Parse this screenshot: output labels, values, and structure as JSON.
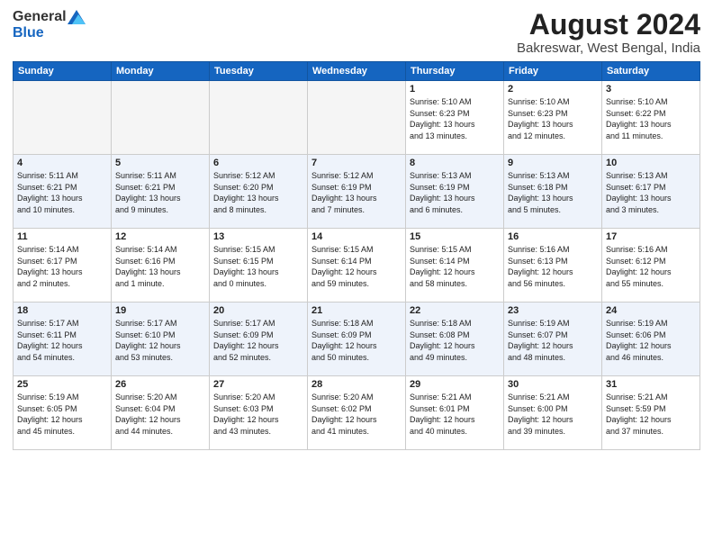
{
  "header": {
    "logo_general": "General",
    "logo_blue": "Blue",
    "main_title": "August 2024",
    "sub_title": "Bakreswar, West Bengal, India"
  },
  "weekdays": [
    "Sunday",
    "Monday",
    "Tuesday",
    "Wednesday",
    "Thursday",
    "Friday",
    "Saturday"
  ],
  "weeks": [
    [
      {
        "day": "",
        "info": ""
      },
      {
        "day": "",
        "info": ""
      },
      {
        "day": "",
        "info": ""
      },
      {
        "day": "",
        "info": ""
      },
      {
        "day": "1",
        "info": "Sunrise: 5:10 AM\nSunset: 6:23 PM\nDaylight: 13 hours\nand 13 minutes."
      },
      {
        "day": "2",
        "info": "Sunrise: 5:10 AM\nSunset: 6:23 PM\nDaylight: 13 hours\nand 12 minutes."
      },
      {
        "day": "3",
        "info": "Sunrise: 5:10 AM\nSunset: 6:22 PM\nDaylight: 13 hours\nand 11 minutes."
      }
    ],
    [
      {
        "day": "4",
        "info": "Sunrise: 5:11 AM\nSunset: 6:21 PM\nDaylight: 13 hours\nand 10 minutes."
      },
      {
        "day": "5",
        "info": "Sunrise: 5:11 AM\nSunset: 6:21 PM\nDaylight: 13 hours\nand 9 minutes."
      },
      {
        "day": "6",
        "info": "Sunrise: 5:12 AM\nSunset: 6:20 PM\nDaylight: 13 hours\nand 8 minutes."
      },
      {
        "day": "7",
        "info": "Sunrise: 5:12 AM\nSunset: 6:19 PM\nDaylight: 13 hours\nand 7 minutes."
      },
      {
        "day": "8",
        "info": "Sunrise: 5:13 AM\nSunset: 6:19 PM\nDaylight: 13 hours\nand 6 minutes."
      },
      {
        "day": "9",
        "info": "Sunrise: 5:13 AM\nSunset: 6:18 PM\nDaylight: 13 hours\nand 5 minutes."
      },
      {
        "day": "10",
        "info": "Sunrise: 5:13 AM\nSunset: 6:17 PM\nDaylight: 13 hours\nand 3 minutes."
      }
    ],
    [
      {
        "day": "11",
        "info": "Sunrise: 5:14 AM\nSunset: 6:17 PM\nDaylight: 13 hours\nand 2 minutes."
      },
      {
        "day": "12",
        "info": "Sunrise: 5:14 AM\nSunset: 6:16 PM\nDaylight: 13 hours\nand 1 minute."
      },
      {
        "day": "13",
        "info": "Sunrise: 5:15 AM\nSunset: 6:15 PM\nDaylight: 13 hours\nand 0 minutes."
      },
      {
        "day": "14",
        "info": "Sunrise: 5:15 AM\nSunset: 6:14 PM\nDaylight: 12 hours\nand 59 minutes."
      },
      {
        "day": "15",
        "info": "Sunrise: 5:15 AM\nSunset: 6:14 PM\nDaylight: 12 hours\nand 58 minutes."
      },
      {
        "day": "16",
        "info": "Sunrise: 5:16 AM\nSunset: 6:13 PM\nDaylight: 12 hours\nand 56 minutes."
      },
      {
        "day": "17",
        "info": "Sunrise: 5:16 AM\nSunset: 6:12 PM\nDaylight: 12 hours\nand 55 minutes."
      }
    ],
    [
      {
        "day": "18",
        "info": "Sunrise: 5:17 AM\nSunset: 6:11 PM\nDaylight: 12 hours\nand 54 minutes."
      },
      {
        "day": "19",
        "info": "Sunrise: 5:17 AM\nSunset: 6:10 PM\nDaylight: 12 hours\nand 53 minutes."
      },
      {
        "day": "20",
        "info": "Sunrise: 5:17 AM\nSunset: 6:09 PM\nDaylight: 12 hours\nand 52 minutes."
      },
      {
        "day": "21",
        "info": "Sunrise: 5:18 AM\nSunset: 6:09 PM\nDaylight: 12 hours\nand 50 minutes."
      },
      {
        "day": "22",
        "info": "Sunrise: 5:18 AM\nSunset: 6:08 PM\nDaylight: 12 hours\nand 49 minutes."
      },
      {
        "day": "23",
        "info": "Sunrise: 5:19 AM\nSunset: 6:07 PM\nDaylight: 12 hours\nand 48 minutes."
      },
      {
        "day": "24",
        "info": "Sunrise: 5:19 AM\nSunset: 6:06 PM\nDaylight: 12 hours\nand 46 minutes."
      }
    ],
    [
      {
        "day": "25",
        "info": "Sunrise: 5:19 AM\nSunset: 6:05 PM\nDaylight: 12 hours\nand 45 minutes."
      },
      {
        "day": "26",
        "info": "Sunrise: 5:20 AM\nSunset: 6:04 PM\nDaylight: 12 hours\nand 44 minutes."
      },
      {
        "day": "27",
        "info": "Sunrise: 5:20 AM\nSunset: 6:03 PM\nDaylight: 12 hours\nand 43 minutes."
      },
      {
        "day": "28",
        "info": "Sunrise: 5:20 AM\nSunset: 6:02 PM\nDaylight: 12 hours\nand 41 minutes."
      },
      {
        "day": "29",
        "info": "Sunrise: 5:21 AM\nSunset: 6:01 PM\nDaylight: 12 hours\nand 40 minutes."
      },
      {
        "day": "30",
        "info": "Sunrise: 5:21 AM\nSunset: 6:00 PM\nDaylight: 12 hours\nand 39 minutes."
      },
      {
        "day": "31",
        "info": "Sunrise: 5:21 AM\nSunset: 5:59 PM\nDaylight: 12 hours\nand 37 minutes."
      }
    ]
  ]
}
